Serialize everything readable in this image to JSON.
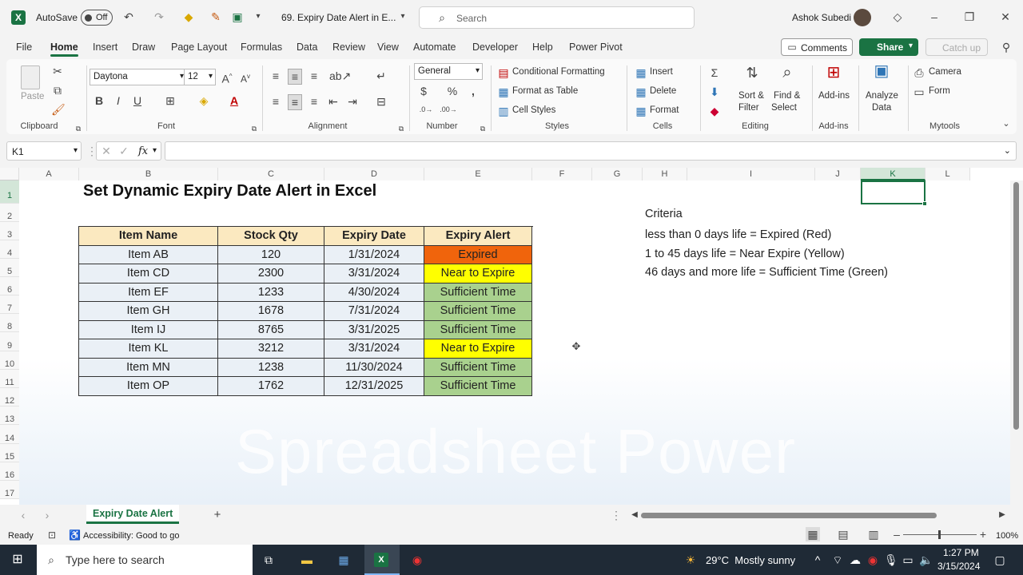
{
  "titlebar": {
    "autosave_label": "AutoSave",
    "autosave_state": "Off",
    "doc_title": "69. Expiry Date Alert in E...",
    "search_placeholder": "Search",
    "user_name": "Ashok Subedi"
  },
  "menu": [
    "File",
    "Home",
    "Insert",
    "Draw",
    "Page Layout",
    "Formulas",
    "Data",
    "Review",
    "View",
    "Automate",
    "Developer",
    "Help",
    "Power Pivot"
  ],
  "menu_right": {
    "comments": "Comments",
    "share": "Share",
    "catchup": "Catch up"
  },
  "ribbon": {
    "clipboard": {
      "paste": "Paste",
      "label": "Clipboard"
    },
    "font": {
      "name": "Daytona",
      "size": "12",
      "label": "Font"
    },
    "alignment": {
      "label": "Alignment"
    },
    "number": {
      "format": "General",
      "label": "Number"
    },
    "styles": {
      "cond": "Conditional Formatting",
      "table": "Format as Table",
      "cellstyles": "Cell Styles",
      "label": "Styles"
    },
    "cells": {
      "insert": "Insert",
      "delete": "Delete",
      "format": "Format",
      "label": "Cells"
    },
    "editing": {
      "sort1": "Sort &",
      "sort2": "Filter",
      "find1": "Find &",
      "find2": "Select",
      "label": "Editing"
    },
    "addins": {
      "btn": "Add-ins",
      "label": "Add-ins"
    },
    "analyze": {
      "l1": "Analyze",
      "l2": "Data"
    },
    "mytools": {
      "camera": "Camera",
      "form": "Form",
      "label": "Mytools"
    }
  },
  "formula": {
    "namebox": "K1",
    "fx": "fx"
  },
  "columns": [
    "A",
    "B",
    "C",
    "D",
    "E",
    "F",
    "G",
    "H",
    "I",
    "J",
    "K",
    "L"
  ],
  "rows": [
    "1",
    "2",
    "3",
    "4",
    "5",
    "6",
    "7",
    "8",
    "9",
    "10",
    "11",
    "12",
    "13",
    "14",
    "15",
    "16",
    "17"
  ],
  "sheet": {
    "title": "Set Dynamic Expiry Date Alert in Excel",
    "headers": [
      "Item Name",
      "Stock Qty",
      "Expiry Date",
      "Expiry Alert"
    ],
    "data": [
      [
        "Item AB",
        "120",
        "1/31/2024",
        "Expired"
      ],
      [
        "Item CD",
        "2300",
        "3/31/2024",
        "Near to Expire"
      ],
      [
        "Item EF",
        "1233",
        "4/30/2024",
        "Sufficient Time"
      ],
      [
        "Item GH",
        "1678",
        "7/31/2024",
        "Sufficient Time"
      ],
      [
        "Item IJ",
        "8765",
        "3/31/2025",
        "Sufficient Time"
      ],
      [
        "Item KL",
        "3212",
        "3/31/2024",
        "Near to Expire"
      ],
      [
        "Item MN",
        "1238",
        "11/30/2024",
        "Sufficient Time"
      ],
      [
        "Item OP",
        "1762",
        "12/31/2025",
        "Sufficient Time"
      ]
    ],
    "alert_colors": {
      "Expired": "#f0640c",
      "Near to Expire": "#ffff00",
      "Sufficient Time": "#a9d18e"
    },
    "criteria": [
      "Criteria",
      "less than 0 days life = Expired (Red)",
      "1 to 45 days life = Near Expire (Yellow)",
      "46 days and more life = Sufficient Time (Green)"
    ],
    "watermark": "Spreadsheet Power"
  },
  "sheet_tab": "Expiry Date Alert",
  "status": {
    "ready": "Ready",
    "accessibility": "Accessibility: Good to go",
    "zoom": "100%"
  },
  "taskbar": {
    "search_placeholder": "Type here to search",
    "weather": "29°C  Mostly sunny",
    "time": "1:27 PM",
    "date": "3/15/2024"
  },
  "colors": {
    "accent": "#1a7343",
    "header_fill": "#fbe9c0"
  }
}
